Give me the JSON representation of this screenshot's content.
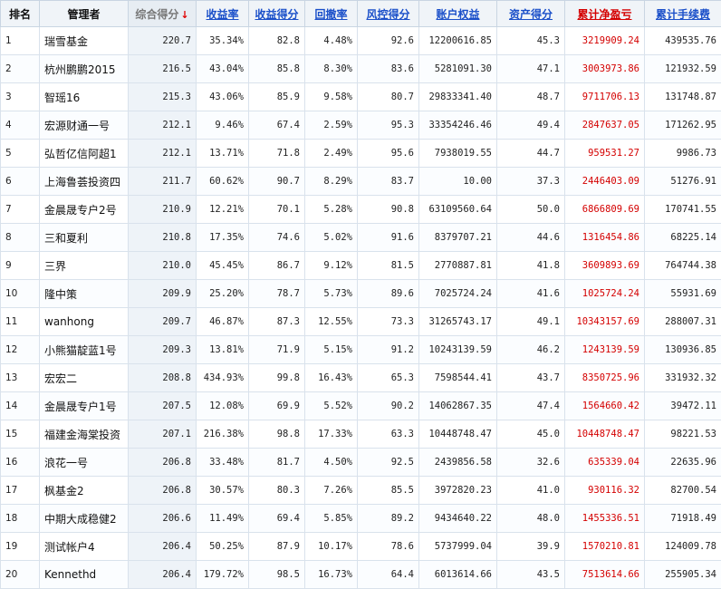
{
  "headers": {
    "rank": "排名",
    "manager": "管理者",
    "total_score": "综合得分",
    "sort_arrow": "↓",
    "return_rate": "收益率",
    "return_score": "收益得分",
    "drawdown": "回撤率",
    "risk_score": "风控得分",
    "equity": "账户权益",
    "asset_score": "资产得分",
    "cum_net_pnl": "累计净盈亏",
    "cum_fee": "累计手续费"
  },
  "colors": {
    "accent_link": "#1a4fc9",
    "red": "#d40000",
    "header_bg": "#f0f4f8"
  },
  "rows": [
    {
      "rank": "1",
      "name": "瑞雪基金",
      "score": "220.7",
      "ret": "35.34%",
      "ret_score": "82.8",
      "dd": "4.48%",
      "risk": "92.6",
      "equity": "12200616.85",
      "asset": "45.3",
      "pnl": "3219909.24",
      "fee": "439535.76"
    },
    {
      "rank": "2",
      "name": "杭州鹏鹏2015",
      "score": "216.5",
      "ret": "43.04%",
      "ret_score": "85.8",
      "dd": "8.30%",
      "risk": "83.6",
      "equity": "5281091.30",
      "asset": "47.1",
      "pnl": "3003973.86",
      "fee": "121932.59"
    },
    {
      "rank": "3",
      "name": "智瑶16",
      "score": "215.3",
      "ret": "43.06%",
      "ret_score": "85.9",
      "dd": "9.58%",
      "risk": "80.7",
      "equity": "29833341.40",
      "asset": "48.7",
      "pnl": "9711706.13",
      "fee": "131748.87"
    },
    {
      "rank": "4",
      "name": "宏源财通一号",
      "score": "212.1",
      "ret": "9.46%",
      "ret_score": "67.4",
      "dd": "2.59%",
      "risk": "95.3",
      "equity": "33354246.46",
      "asset": "49.4",
      "pnl": "2847637.05",
      "fee": "171262.95"
    },
    {
      "rank": "5",
      "name": "弘哲亿信阿超1",
      "score": "212.1",
      "ret": "13.71%",
      "ret_score": "71.8",
      "dd": "2.49%",
      "risk": "95.6",
      "equity": "7938019.55",
      "asset": "44.7",
      "pnl": "959531.27",
      "fee": "9986.73"
    },
    {
      "rank": "6",
      "name": "上海鲁荟投资四",
      "score": "211.7",
      "ret": "60.62%",
      "ret_score": "90.7",
      "dd": "8.29%",
      "risk": "83.7",
      "equity": "10.00",
      "asset": "37.3",
      "pnl": "2446403.09",
      "fee": "51276.91"
    },
    {
      "rank": "7",
      "name": "金晨晟专户2号",
      "score": "210.9",
      "ret": "12.21%",
      "ret_score": "70.1",
      "dd": "5.28%",
      "risk": "90.8",
      "equity": "63109560.64",
      "asset": "50.0",
      "pnl": "6866809.69",
      "fee": "170741.55"
    },
    {
      "rank": "8",
      "name": "三和夏利",
      "score": "210.8",
      "ret": "17.35%",
      "ret_score": "74.6",
      "dd": "5.02%",
      "risk": "91.6",
      "equity": "8379707.21",
      "asset": "44.6",
      "pnl": "1316454.86",
      "fee": "68225.14"
    },
    {
      "rank": "9",
      "name": "三界",
      "score": "210.0",
      "ret": "45.45%",
      "ret_score": "86.7",
      "dd": "9.12%",
      "risk": "81.5",
      "equity": "2770887.81",
      "asset": "41.8",
      "pnl": "3609893.69",
      "fee": "764744.38"
    },
    {
      "rank": "10",
      "name": "隆中策",
      "score": "209.9",
      "ret": "25.20%",
      "ret_score": "78.7",
      "dd": "5.73%",
      "risk": "89.6",
      "equity": "7025724.24",
      "asset": "41.6",
      "pnl": "1025724.24",
      "fee": "55931.69"
    },
    {
      "rank": "11",
      "name": "wanhong",
      "score": "209.7",
      "ret": "46.87%",
      "ret_score": "87.3",
      "dd": "12.55%",
      "risk": "73.3",
      "equity": "31265743.17",
      "asset": "49.1",
      "pnl": "10343157.69",
      "fee": "288007.31"
    },
    {
      "rank": "12",
      "name": "小熊猫靛蓝1号",
      "score": "209.3",
      "ret": "13.81%",
      "ret_score": "71.9",
      "dd": "5.15%",
      "risk": "91.2",
      "equity": "10243139.59",
      "asset": "46.2",
      "pnl": "1243139.59",
      "fee": "130936.85"
    },
    {
      "rank": "13",
      "name": "宏宏二",
      "score": "208.8",
      "ret": "434.93%",
      "ret_score": "99.8",
      "dd": "16.43%",
      "risk": "65.3",
      "equity": "7598544.41",
      "asset": "43.7",
      "pnl": "8350725.96",
      "fee": "331932.32"
    },
    {
      "rank": "14",
      "name": "金晨晟专户1号",
      "score": "207.5",
      "ret": "12.08%",
      "ret_score": "69.9",
      "dd": "5.52%",
      "risk": "90.2",
      "equity": "14062867.35",
      "asset": "47.4",
      "pnl": "1564660.42",
      "fee": "39472.11"
    },
    {
      "rank": "15",
      "name": "福建金海棠投资",
      "score": "207.1",
      "ret": "216.38%",
      "ret_score": "98.8",
      "dd": "17.33%",
      "risk": "63.3",
      "equity": "10448748.47",
      "asset": "45.0",
      "pnl": "10448748.47",
      "fee": "98221.53"
    },
    {
      "rank": "16",
      "name": "浪花一号",
      "score": "206.8",
      "ret": "33.48%",
      "ret_score": "81.7",
      "dd": "4.50%",
      "risk": "92.5",
      "equity": "2439856.58",
      "asset": "32.6",
      "pnl": "635339.04",
      "fee": "22635.96"
    },
    {
      "rank": "17",
      "name": "枫基金2",
      "score": "206.8",
      "ret": "30.57%",
      "ret_score": "80.3",
      "dd": "7.26%",
      "risk": "85.5",
      "equity": "3972820.23",
      "asset": "41.0",
      "pnl": "930116.32",
      "fee": "82700.54"
    },
    {
      "rank": "18",
      "name": "中期大成稳健2",
      "score": "206.6",
      "ret": "11.49%",
      "ret_score": "69.4",
      "dd": "5.85%",
      "risk": "89.2",
      "equity": "9434640.22",
      "asset": "48.0",
      "pnl": "1455336.51",
      "fee": "71918.49"
    },
    {
      "rank": "19",
      "name": "测试帐户4",
      "score": "206.4",
      "ret": "50.25%",
      "ret_score": "87.9",
      "dd": "10.17%",
      "risk": "78.6",
      "equity": "5737999.04",
      "asset": "39.9",
      "pnl": "1570210.81",
      "fee": "124009.78"
    },
    {
      "rank": "20",
      "name": "Kennethd",
      "score": "206.4",
      "ret": "179.72%",
      "ret_score": "98.5",
      "dd": "16.73%",
      "risk": "64.4",
      "equity": "6013614.66",
      "asset": "43.5",
      "pnl": "7513614.66",
      "fee": "255905.34"
    }
  ]
}
